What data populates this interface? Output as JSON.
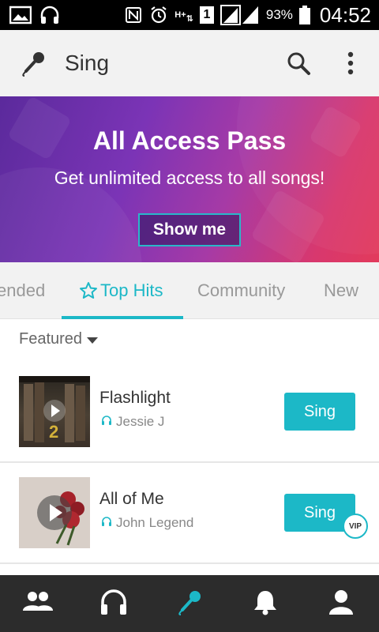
{
  "status_bar": {
    "battery": "93%",
    "time": "04:52",
    "network_type": "H+",
    "sim_slot": "1"
  },
  "app_bar": {
    "title": "Sing"
  },
  "banner": {
    "title": "All Access Pass",
    "subtitle": "Get unlimited access to all songs!",
    "button_label": "Show me"
  },
  "tabs": [
    {
      "label": "ended",
      "active": false
    },
    {
      "label": "Top Hits",
      "active": true
    },
    {
      "label": "Community",
      "active": false
    },
    {
      "label": "New",
      "active": false
    }
  ],
  "section": {
    "filter_label": "Featured"
  },
  "songs": [
    {
      "title": "Flashlight",
      "artist": "Jessie J",
      "button": "Sing",
      "vip": false
    },
    {
      "title": "All of Me",
      "artist": "John Legend",
      "button": "Sing",
      "vip": true,
      "vip_label": "VIP"
    }
  ],
  "bottom_nav": [
    {
      "icon": "friends-icon",
      "active": false
    },
    {
      "icon": "headphones-icon",
      "active": false
    },
    {
      "icon": "microphone-icon",
      "active": true
    },
    {
      "icon": "bell-icon",
      "active": false
    },
    {
      "icon": "profile-icon",
      "active": false
    }
  ],
  "colors": {
    "accent": "#1cb8c7",
    "nav_bg": "#2c2c2c",
    "appbar_bg": "#f2f2f2"
  }
}
